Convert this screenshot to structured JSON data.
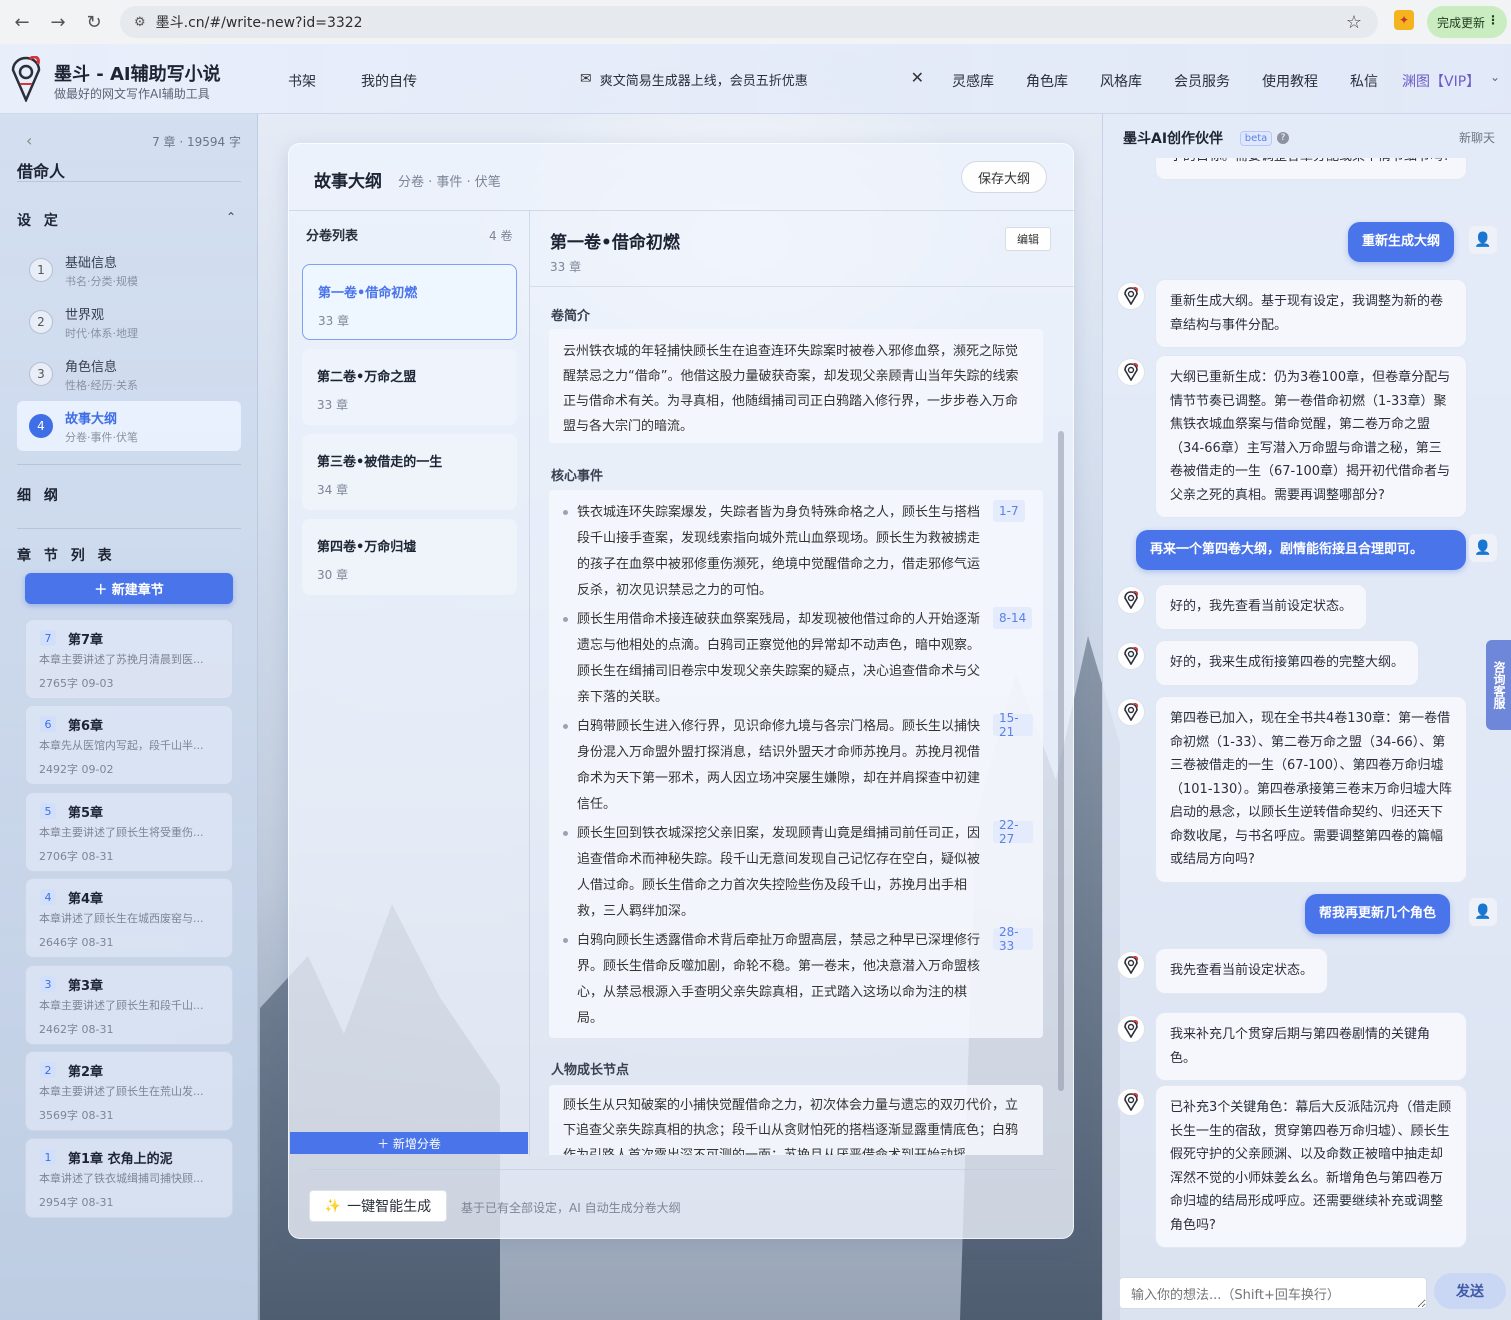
{
  "browser": {
    "url": "墨斗.cn/#/write-new?id=3322",
    "update_label": "完成更新"
  },
  "topnav": {
    "brand_title": "墨斗 - AI辅助写小说",
    "brand_subtitle": "做最好的网文写作AI辅助工具",
    "links": {
      "bookshelf": "书架",
      "autobiography": "我的自传",
      "inspiration": "灵感库",
      "characters": "角色库",
      "styles": "风格库",
      "membership": "会员服务",
      "tutorial": "使用教程",
      "messages": "私信"
    },
    "announcement": "爽文简易生成器上线，会员五折优惠",
    "user": "渊图【VIP】"
  },
  "sidebar": {
    "stats": "7 章 · 19594 字",
    "book_title": "借命人",
    "settings_label": "设 定",
    "steps": [
      {
        "num": "1",
        "title": "基础信息",
        "sub": "书名·分类·规模"
      },
      {
        "num": "2",
        "title": "世界观",
        "sub": "时代·体系·地理"
      },
      {
        "num": "3",
        "title": "角色信息",
        "sub": "性格·经历·关系"
      },
      {
        "num": "4",
        "title": "故事大纲",
        "sub": "分卷·事件·伏笔"
      }
    ],
    "detail_outline_label": "细 纲",
    "chapter_list_label": "章 节 列 表",
    "new_chapter_label": "＋ 新建章节",
    "chapters": [
      {
        "num": "7",
        "title": "第7章",
        "summary": "本章主要讲述了苏挽月清晨到医...",
        "meta": "2765字  09-03"
      },
      {
        "num": "6",
        "title": "第6章",
        "summary": "本章先从医馆内写起，段千山半...",
        "meta": "2492字  09-02"
      },
      {
        "num": "5",
        "title": "第5章",
        "summary": "本章主要讲述了顾长生将受重伤...",
        "meta": "2706字  08-31"
      },
      {
        "num": "4",
        "title": "第4章",
        "summary": "本章讲述了顾长生在城西废窑与...",
        "meta": "2646字  08-31"
      },
      {
        "num": "3",
        "title": "第3章",
        "summary": "本章主要讲述了顾长生和段千山...",
        "meta": "2462字  08-31"
      },
      {
        "num": "2",
        "title": "第2章",
        "summary": "本章主要讲述了顾长生在荒山发...",
        "meta": "3569字  08-31"
      },
      {
        "num": "1",
        "title": "第1章 衣角上的泥",
        "summary": "本章讲述了铁衣城缉捕司捕快顾...",
        "meta": "2954字  08-31"
      }
    ]
  },
  "outline": {
    "title": "故事大纲",
    "subtitle": "分卷 · 事件 · 伏笔",
    "save_label": "保存大纲",
    "volume_list_label": "分卷列表",
    "volume_count": "4 卷",
    "volumes": [
      {
        "name": "第一卷•借命初燃",
        "chapters": "33 章"
      },
      {
        "name": "第二卷•万命之盟",
        "chapters": "33 章"
      },
      {
        "name": "第三卷•被借走的一生",
        "chapters": "34 章"
      },
      {
        "name": "第四卷•万命归墟",
        "chapters": "30 章"
      }
    ],
    "add_volume_label": "＋ 新增分卷",
    "detail": {
      "title": "第一卷•借命初燃",
      "chapters": "33 章",
      "edit_label": "编辑",
      "intro_label": "卷简介",
      "intro": "云州铁衣城的年轻捕快顾长生在追查连环失踪案时被卷入邪修血祭，濒死之际觉醒禁忌之力“借命”。他借这股力量破获奇案，却发现父亲顾青山当年失踪的线索正与借命术有关。为寻真相，他随缉捕司司正白鸦踏入修行界，一步步卷入万命盟与各大宗门的暗流。",
      "events_label": "核心事件",
      "events": [
        {
          "text": "铁衣城连环失踪案爆发，失踪者皆为身负特殊命格之人，顾长生与搭档段千山接手查案，发现线索指向城外荒山血祭现场。顾长生为救被掳走的孩子在血祭中被邪修重伤濒死，绝境中觉醒借命之力，借走邪修气运反杀，初次见识禁忌之力的可怕。",
          "range": "1-7"
        },
        {
          "text": "顾长生用借命术接连破获血祭案残局，却发现被他借过命的人开始逐渐遗忘与他相处的点滴。白鸦司正察觉他的异常却不动声色，暗中观察。顾长生在缉捕司旧卷宗中发现父亲失踪案的疑点，决心追查借命术与父亲下落的关联。",
          "range": "8-14"
        },
        {
          "text": "白鸦带顾长生进入修行界，见识命修九境与各宗门格局。顾长生以捕快身份混入万命盟外盟打探消息，结识外盟天才命师苏挽月。苏挽月视借命术为天下第一邪术，两人因立场冲突屡生嫌隙，却在并肩探查中初建信任。",
          "range": "15-21"
        },
        {
          "text": "顾长生回到铁衣城深挖父亲旧案，发现顾青山竟是缉捕司前任司正，因追查借命术而神秘失踪。段千山无意间发现自己记忆存在空白，疑似被人借过命。顾长生借命之力首次失控险些伤及段千山，苏挽月出手相救，三人羁绊加深。",
          "range": "22-27"
        },
        {
          "text": "白鸦向顾长生透露借命术背后牵扯万命盟高层，禁忌之种早已深埋修行界。顾长生借命反噬加剧，命轮不稳。第一卷末，他决意潜入万命盟核心，从禁忌根源入手查明父亲失踪真相，正式踏入这场以命为注的棋局。",
          "range": "28-33"
        }
      ],
      "growth_label": "人物成长节点",
      "growth": "顾长生从只知破案的小捕快觉醒借命之力，初次体会力量与遗忘的双刃代价，立下追查父亲失踪真相的执念；段千山从贪财怕死的搭档逐渐显露重情底色；白鸦作为引路人首次露出深不可测的一面；苏挽月从厌恶借命术到开始动摇。"
    },
    "generate_label": "一键智能生成",
    "generate_hint": "基于已有全部设定，AI 自动生成分卷大纲"
  },
  "chat": {
    "title": "墨斗AI创作伙伴",
    "beta": "beta",
    "new_chat": "新聊天",
    "messages": [
      {
        "role": "ai",
        "text": "字的目标。需要调整各章分配或某个情节细节吗?"
      },
      {
        "role": "user",
        "text": "重新生成大纲"
      },
      {
        "role": "ai",
        "text": "重新生成大纲。基于现有设定，我调整为新的卷章结构与事件分配。"
      },
      {
        "role": "ai",
        "text": "大纲已重新生成：仍为3卷100章，但卷章分配与情节节奏已调整。第一卷借命初燃（1-33章）聚焦铁衣城血祭案与借命觉醒，第二卷万命之盟（34-66章）主写潜入万命盟与命谱之秘，第三卷被借走的一生（67-100章）揭开初代借命者与父亲之死的真相。需要再调整哪部分?"
      },
      {
        "role": "user",
        "text": "再来一个第四卷大纲，剧情能衔接且合理即可。"
      },
      {
        "role": "ai",
        "text": "好的，我先查看当前设定状态。"
      },
      {
        "role": "ai",
        "text": "好的，我来生成衔接第四卷的完整大纲。"
      },
      {
        "role": "ai",
        "text": "第四卷已加入，现在全书共4卷130章：第一卷借命初燃（1-33）、第二卷万命之盟（34-66）、第三卷被借走的一生（67-100）、第四卷万命归墟（101-130）。第四卷承接第三卷末万命归墟大阵启动的悬念，以顾长生逆转借命契约、归还天下命数收尾，与书名呼应。需要调整第四卷的篇幅或结局方向吗?"
      },
      {
        "role": "user",
        "text": "帮我再更新几个角色"
      },
      {
        "role": "ai",
        "text": "我先查看当前设定状态。"
      },
      {
        "role": "ai",
        "text": "我来补充几个贯穿后期与第四卷剧情的关键角色。"
      },
      {
        "role": "ai",
        "text": "已补充3个关键角色：幕后大反派陆沉舟（借走顾长生一生的宿敌，贯穿第四卷万命归墟）、顾长生假死守护的父亲顾渊、以及命数正被暗中抽走却浑然不觉的小师妹姜幺幺。新增角色与第四卷万命归墟的结局形成呼应。还需要继续补充或调整角色吗?"
      }
    ],
    "input_placeholder": "输入你的想法...（Shift+回车换行）",
    "send_label": "发送",
    "service_tab": "咨询客服"
  }
}
